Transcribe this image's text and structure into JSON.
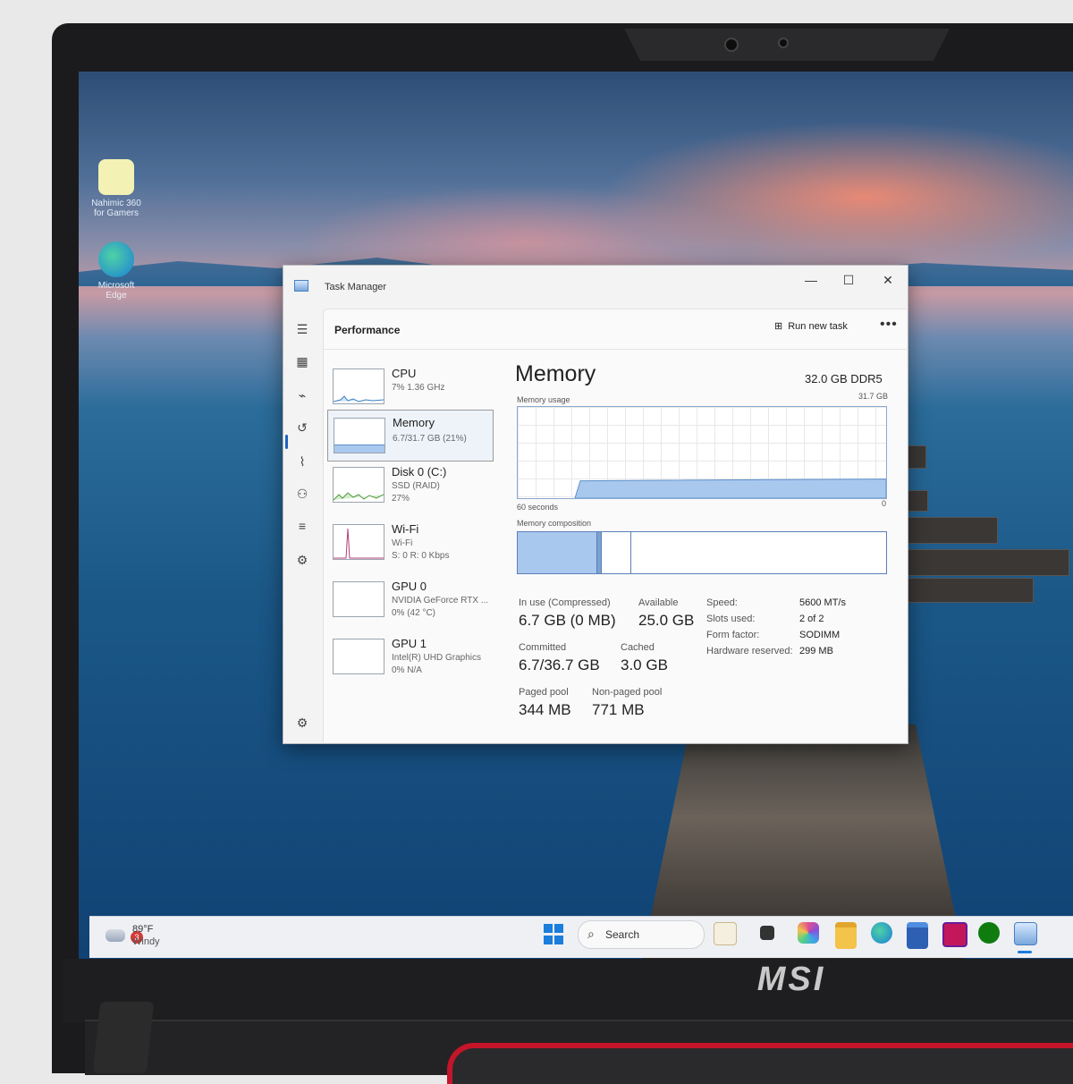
{
  "brand": "MSI",
  "desktop": {
    "icons": [
      {
        "label": "Nahimic 360 for Gamers",
        "icon": "app-shortcut-icon"
      },
      {
        "label": "Microsoft Edge",
        "icon": "edge-icon"
      }
    ]
  },
  "task_manager": {
    "title": "Task Manager",
    "header": "Performance",
    "run_new_task": "Run new task",
    "more": "•••",
    "window_controls": {
      "minimize": "—",
      "maximize": "☐",
      "close": "✕"
    },
    "nav_icons": [
      "hamburger-icon",
      "processes-icon",
      "performance-icon",
      "app-history-icon",
      "startup-icon",
      "users-icon",
      "details-icon",
      "services-icon",
      "settings-icon"
    ],
    "resources": [
      {
        "name": "CPU",
        "sub1": "7%  1.36 GHz",
        "sub2": ""
      },
      {
        "name": "Memory",
        "sub1": "6.7/31.7 GB (21%)",
        "sub2": ""
      },
      {
        "name": "Disk 0 (C:)",
        "sub1": "SSD (RAID)",
        "sub2": "27%"
      },
      {
        "name": "Wi-Fi",
        "sub1": "Wi-Fi",
        "sub2": "S: 0  R: 0 Kbps"
      },
      {
        "name": "GPU 0",
        "sub1": "NVIDIA GeForce RTX ...",
        "sub2": "0%  (42 °C)"
      },
      {
        "name": "GPU 1",
        "sub1": "Intel(R) UHD Graphics",
        "sub2": "0%  N/A"
      }
    ],
    "memory": {
      "title": "Memory",
      "spec": "32.0 GB DDR5",
      "usage_label": "Memory usage",
      "usage_max": "31.7 GB",
      "time_label": "60 seconds",
      "zero": "0",
      "composition_label": "Memory composition",
      "usage_fraction": 0.21,
      "stats": {
        "in_use_label": "In use (Compressed)",
        "in_use": "6.7 GB (0 MB)",
        "available_label": "Available",
        "available": "25.0 GB",
        "committed_label": "Committed",
        "committed": "6.7/36.7 GB",
        "cached_label": "Cached",
        "cached": "3.0 GB",
        "paged_label": "Paged pool",
        "paged": "344 MB",
        "nonpaged_label": "Non-paged pool",
        "nonpaged": "771 MB"
      },
      "details": [
        {
          "label": "Speed:",
          "value": "5600 MT/s"
        },
        {
          "label": "Slots used:",
          "value": "2 of 2"
        },
        {
          "label": "Form factor:",
          "value": "SODIMM"
        },
        {
          "label": "Hardware reserved:",
          "value": "299 MB"
        }
      ]
    }
  },
  "taskbar": {
    "weather_badge": "3",
    "temperature": "89°F",
    "condition": "Windy",
    "search_placeholder": "Search",
    "icons": [
      "start-icon",
      "search-icon",
      "widgets-icon",
      "task-view-icon",
      "m365-icon",
      "file-explorer-icon",
      "edge-icon",
      "store-icon",
      "app-icon",
      "xbox-icon",
      "task-manager-icon"
    ]
  }
}
